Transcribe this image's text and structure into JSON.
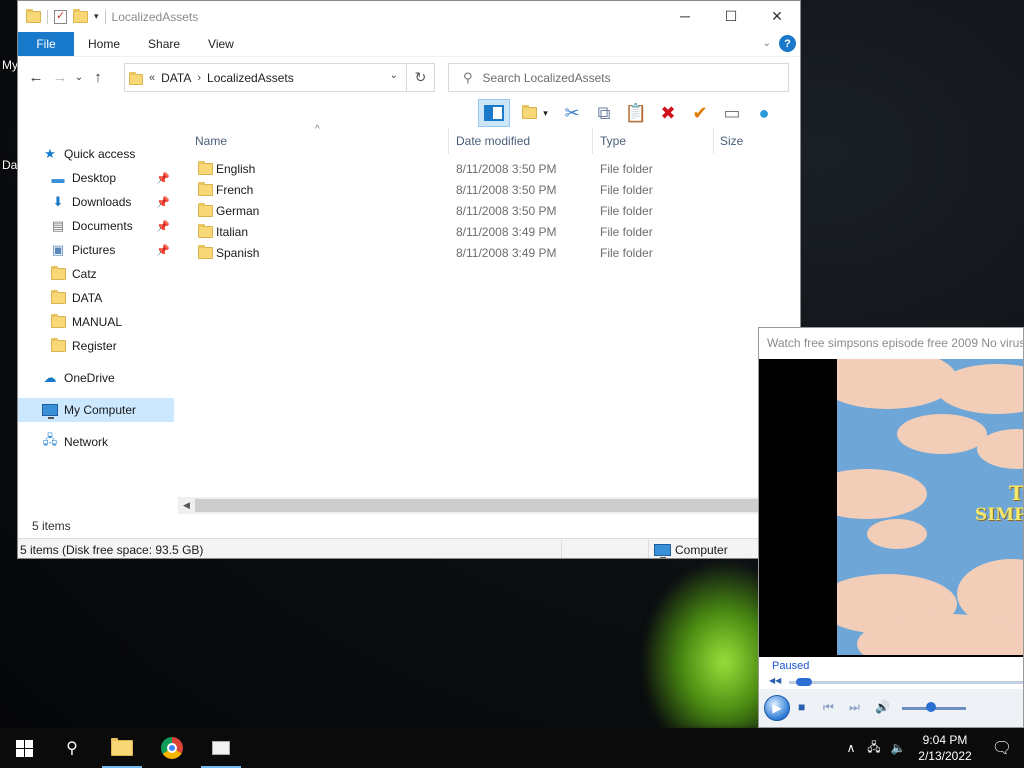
{
  "desktop": {
    "label_top": "My",
    "label_mid": "Da"
  },
  "explorer": {
    "title": "LocalizedAssets",
    "tabs": [
      "File",
      "Home",
      "Share",
      "View"
    ],
    "breadcrumb": [
      "DATA",
      "LocalizedAssets"
    ],
    "breadcrumb_overflow": "«",
    "search_placeholder": "Search LocalizedAssets",
    "columns": [
      "Name",
      "Date modified",
      "Type",
      "Size"
    ],
    "files": [
      {
        "name": "English",
        "date": "8/11/2008 3:50 PM",
        "type": "File folder"
      },
      {
        "name": "French",
        "date": "8/11/2008 3:50 PM",
        "type": "File folder"
      },
      {
        "name": "German",
        "date": "8/11/2008 3:50 PM",
        "type": "File folder"
      },
      {
        "name": "Italian",
        "date": "8/11/2008 3:49 PM",
        "type": "File folder"
      },
      {
        "name": "Spanish",
        "date": "8/11/2008 3:49 PM",
        "type": "File folder"
      }
    ],
    "sidebar": {
      "quick_access": "Quick access",
      "pinned": [
        "Desktop",
        "Downloads",
        "Documents",
        "Pictures"
      ],
      "folders": [
        "Catz",
        "DATA",
        "MANUAL",
        "Register"
      ],
      "onedrive": "OneDrive",
      "my_computer": "My Computer",
      "network": "Network"
    },
    "item_count": "5 items",
    "status_left": "5 items (Disk free space: 93.5 GB)",
    "status_right": "Computer"
  },
  "player": {
    "title": "Watch free simpsons episode free 2009 No virus p",
    "status": "Paused",
    "video_text_1": "T",
    "video_text_2": "SIMP",
    "seek_position": 0.03,
    "volume_level": 0.45
  },
  "taskbar": {
    "time": "9:04 PM",
    "date": "2/13/2022"
  }
}
